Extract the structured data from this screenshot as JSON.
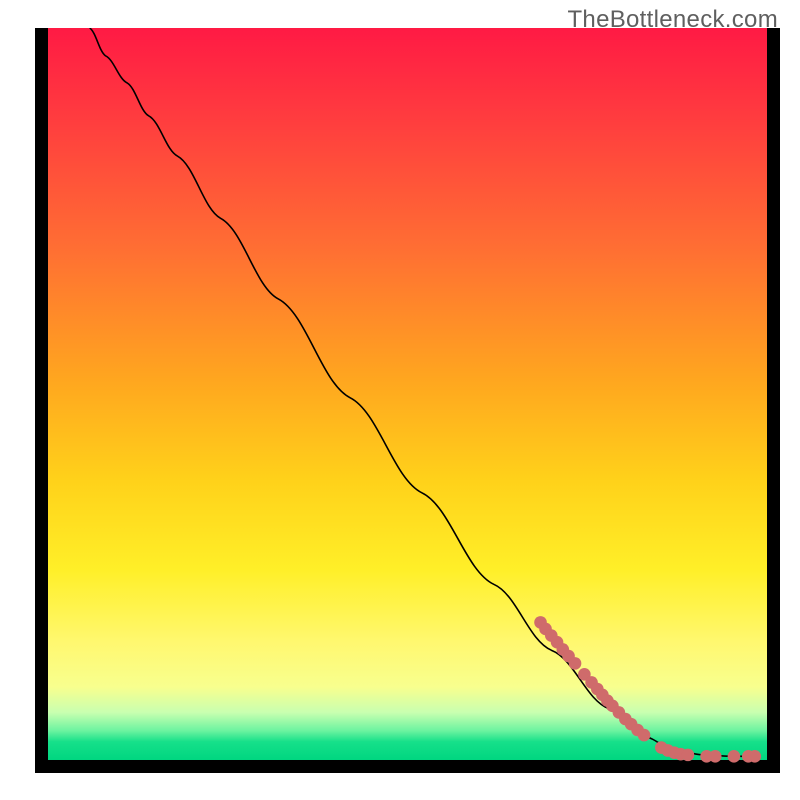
{
  "watermark": "TheBottleneck.com",
  "chart_data": {
    "type": "line",
    "title": "",
    "xlabel": "",
    "ylabel": "",
    "xlim": [
      0,
      100
    ],
    "ylim": [
      0,
      100
    ],
    "gradient_stops": [
      {
        "offset": 0,
        "color": "#ff1a44"
      },
      {
        "offset": 12,
        "color": "#ff3b3f"
      },
      {
        "offset": 30,
        "color": "#ff6e33"
      },
      {
        "offset": 48,
        "color": "#ffa61f"
      },
      {
        "offset": 62,
        "color": "#ffd21a"
      },
      {
        "offset": 74,
        "color": "#ffef28"
      },
      {
        "offset": 84,
        "color": "#fff870"
      },
      {
        "offset": 90,
        "color": "#f8ff8e"
      },
      {
        "offset": 93.5,
        "color": "#c9ffb0"
      },
      {
        "offset": 96,
        "color": "#6cf3a0"
      },
      {
        "offset": 97.5,
        "color": "#16e08a"
      },
      {
        "offset": 100,
        "color": "#00d680"
      }
    ],
    "curve": [
      {
        "x": 5.8,
        "y": 100
      },
      {
        "x": 8.0,
        "y": 96.2
      },
      {
        "x": 11.0,
        "y": 92.5
      },
      {
        "x": 14.0,
        "y": 88.0
      },
      {
        "x": 18.0,
        "y": 82.5
      },
      {
        "x": 24.0,
        "y": 74.0
      },
      {
        "x": 32.0,
        "y": 63.0
      },
      {
        "x": 42.0,
        "y": 49.5
      },
      {
        "x": 52.0,
        "y": 36.5
      },
      {
        "x": 62.0,
        "y": 24.0
      },
      {
        "x": 70.0,
        "y": 15.0
      },
      {
        "x": 78.0,
        "y": 7.0
      },
      {
        "x": 83.0,
        "y": 3.2
      },
      {
        "x": 87.0,
        "y": 1.4
      },
      {
        "x": 91.0,
        "y": 0.7
      },
      {
        "x": 95.0,
        "y": 0.5
      },
      {
        "x": 99.0,
        "y": 0.5
      }
    ],
    "markers": [
      {
        "x": 68.5,
        "y": 18.8
      },
      {
        "x": 69.2,
        "y": 17.9
      },
      {
        "x": 70.0,
        "y": 17.0
      },
      {
        "x": 70.8,
        "y": 16.1
      },
      {
        "x": 71.6,
        "y": 15.1
      },
      {
        "x": 72.4,
        "y": 14.2
      },
      {
        "x": 73.3,
        "y": 13.2
      },
      {
        "x": 74.6,
        "y": 11.7
      },
      {
        "x": 75.6,
        "y": 10.6
      },
      {
        "x": 76.4,
        "y": 9.7
      },
      {
        "x": 77.1,
        "y": 8.9
      },
      {
        "x": 77.8,
        "y": 8.1
      },
      {
        "x": 78.5,
        "y": 7.4
      },
      {
        "x": 79.4,
        "y": 6.5
      },
      {
        "x": 80.3,
        "y": 5.6
      },
      {
        "x": 81.1,
        "y": 4.9
      },
      {
        "x": 82.0,
        "y": 4.1
      },
      {
        "x": 82.9,
        "y": 3.4
      },
      {
        "x": 85.3,
        "y": 1.7
      },
      {
        "x": 86.2,
        "y": 1.3
      },
      {
        "x": 87.1,
        "y": 1.0
      },
      {
        "x": 88.0,
        "y": 0.8
      },
      {
        "x": 89.0,
        "y": 0.7
      },
      {
        "x": 91.6,
        "y": 0.5
      },
      {
        "x": 92.8,
        "y": 0.5
      },
      {
        "x": 95.4,
        "y": 0.5
      },
      {
        "x": 97.4,
        "y": 0.5
      },
      {
        "x": 98.3,
        "y": 0.5
      }
    ],
    "marker_color": "#cf6b6b",
    "curve_color": "#000000"
  }
}
